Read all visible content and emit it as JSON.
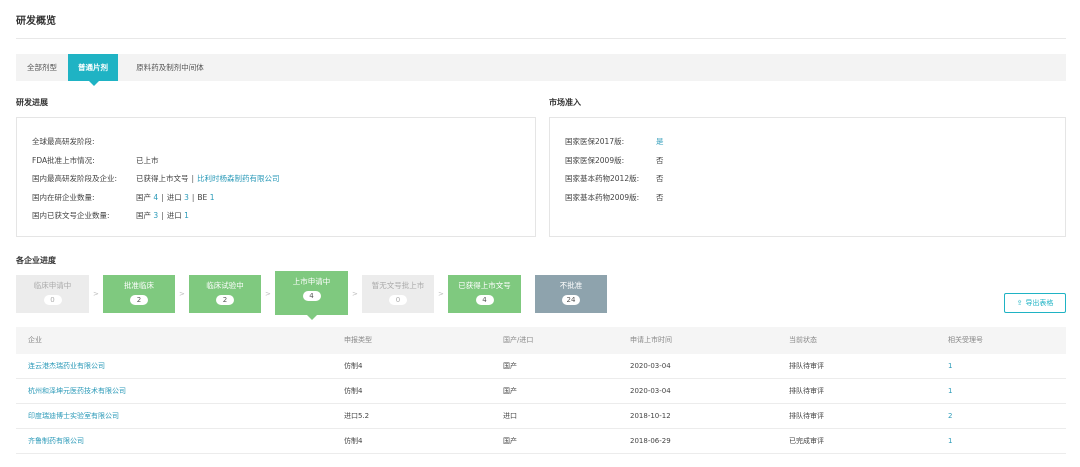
{
  "page": {
    "title": "研发概览"
  },
  "tabs": [
    {
      "label": "全部剂型"
    },
    {
      "label": "普通片剂"
    },
    {
      "label": "原料药及制剂中间体"
    }
  ],
  "rd_progress": {
    "title": "研发进展",
    "rows": {
      "global_stage": {
        "label": "全球最高研发阶段:"
      },
      "fda": {
        "label": "FDA批准上市情况:",
        "value": "已上市"
      },
      "domestic_stage": {
        "label": "国内最高研发阶段及企业:",
        "value": "已获得上市文号",
        "sep": "|",
        "company": "比利时杨森制药有限公司"
      },
      "domestic_count": {
        "label": "国内在研企业数量:",
        "domestic_label": "国产",
        "domestic_value": "4",
        "import_label": "进口",
        "import_value": "3",
        "be_label": "BE",
        "be_value": "1",
        "sep": "|"
      },
      "approved_count": {
        "label": "国内已获文号企业数量:",
        "domestic_label": "国产",
        "domestic_value": "3",
        "import_label": "进口",
        "import_value": "1",
        "sep": "|"
      }
    }
  },
  "market_access": {
    "title": "市场准入",
    "rows": [
      {
        "label": "国家医保2017版:",
        "value": "是",
        "highlight": true
      },
      {
        "label": "国家医保2009版:",
        "value": "否",
        "highlight": false
      },
      {
        "label": "国家基本药物2012版:",
        "value": "否",
        "highlight": false
      },
      {
        "label": "国家基本药物2009版:",
        "value": "否",
        "highlight": false
      }
    ]
  },
  "company_progress": {
    "title": "各企业进度",
    "steps": [
      {
        "label": "临床申请中",
        "count": "0",
        "style": "gray"
      },
      {
        "label": "批准临床",
        "count": "2",
        "style": "green"
      },
      {
        "label": "临床试验中",
        "count": "2",
        "style": "green"
      },
      {
        "label": "上市申请中",
        "count": "4",
        "style": "green",
        "active": true
      },
      {
        "label": "暂无文号批上市",
        "count": "0",
        "style": "gray"
      },
      {
        "label": "已获得上市文号",
        "count": "4",
        "style": "green"
      },
      {
        "label": "不批准",
        "count": "24",
        "style": "dark"
      }
    ],
    "step_arrow": ">",
    "export_label": "导出表格"
  },
  "table": {
    "headers": [
      "企业",
      "申报类型",
      "国产/进口",
      "申请上市时间",
      "当前状态",
      "相关受理号"
    ],
    "rows": [
      [
        "连云港杰瑞药业有限公司",
        "仿制4",
        "国产",
        "2020-03-04",
        "排队待审评",
        "1"
      ],
      [
        "杭州和泽坤元医药技术有限公司",
        "仿制4",
        "国产",
        "2020-03-04",
        "排队待审评",
        "1"
      ],
      [
        "印度瑞迪博士实验室有限公司",
        "进口5.2",
        "进口",
        "2018-10-12",
        "排队待审评",
        "2"
      ],
      [
        "齐鲁制药有限公司",
        "仿制4",
        "国产",
        "2018-06-29",
        "已完成审评",
        "1"
      ]
    ]
  },
  "colors": {
    "accent": "#1fb3c4",
    "green": "#7fc97f",
    "gray": "#ececec",
    "dark": "#8ea3ad",
    "link": "#2b9ab8"
  }
}
